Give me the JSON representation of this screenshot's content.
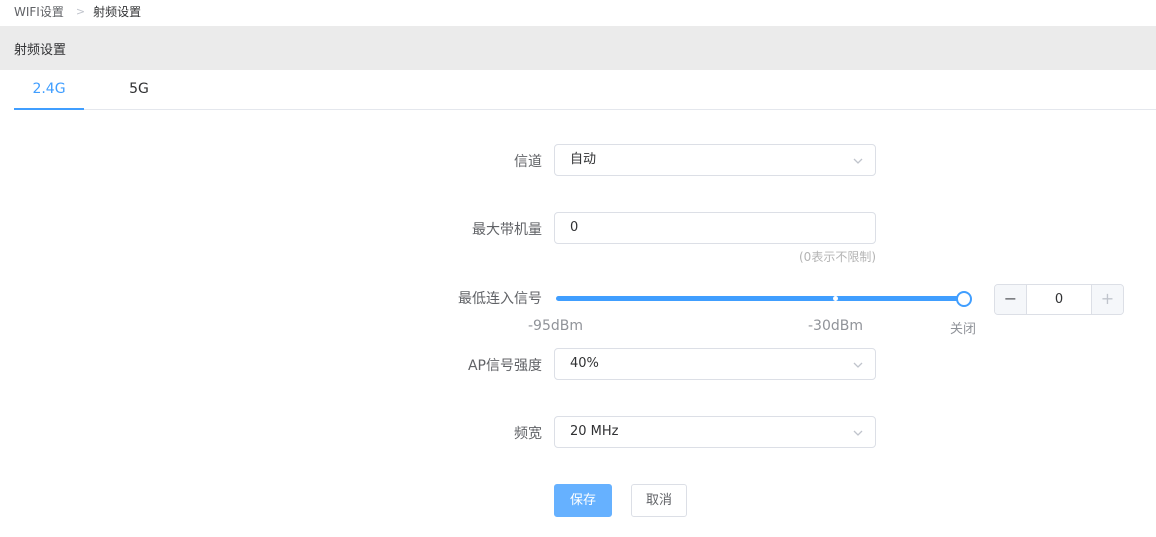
{
  "breadcrumb": {
    "root": "WIFI设置",
    "separator": ">",
    "current": "射频设置"
  },
  "section": {
    "title": "射频设置"
  },
  "tabs": [
    {
      "label": "2.4G",
      "active": true
    },
    {
      "label": "5G",
      "active": false
    }
  ],
  "form": {
    "channel": {
      "label": "信道",
      "value": "自动"
    },
    "max_bandwidth": {
      "label": "最大带机量",
      "value": "0",
      "hint": "(0表示不限制)"
    },
    "min_signal": {
      "label": "最低连入信号",
      "marks": [
        "-95dBm",
        "-30dBm",
        "关闭"
      ],
      "slider_level": "关闭",
      "stepper_value": "0",
      "minus_label": "−",
      "plus_label": "+"
    },
    "ap_power": {
      "label": "AP信号强度",
      "value": "40%"
    },
    "bandwidth": {
      "label": "频宽",
      "value": "20 MHz"
    }
  },
  "actions": {
    "save_label": "保存",
    "cancel_label": "取消"
  },
  "colors": {
    "accent": "#409eff",
    "save_button": "#66b1ff",
    "header_bg": "#ebebeb"
  },
  "icons": {
    "select_arrow": "chevron-down-icon"
  }
}
